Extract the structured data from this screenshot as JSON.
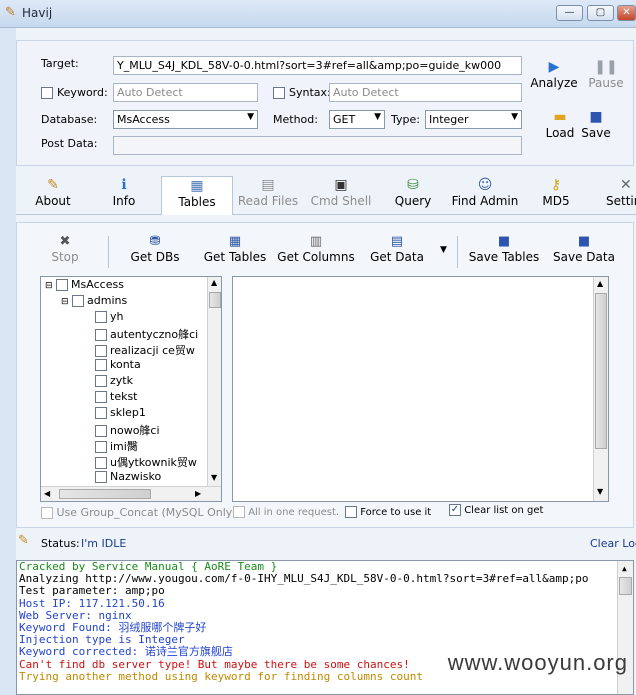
{
  "window": {
    "title": "Havij",
    "min": "▭",
    "max": "◻",
    "close": "✕"
  },
  "form": {
    "target_label": "Target:",
    "target_value": "Y_MLU_S4J_KDL_58V-0-0.html?sort=3#ref=all&amp;po=guide_kw000",
    "keyword_label": "Keyword:",
    "keyword_placeholder": "Auto Detect",
    "syntax_label": "Syntax:",
    "syntax_placeholder": "Auto Detect",
    "database_label": "Database:",
    "database_value": "MsAccess",
    "method_label": "Method:",
    "method_value": "GET",
    "type_label": "Type:",
    "type_value": "Integer",
    "postdata_label": "Post Data:",
    "analyze": "Analyze",
    "pause": "Pause",
    "load": "Load",
    "save": "Save"
  },
  "tabs": [
    {
      "label": "About",
      "icon": "brush-icon"
    },
    {
      "label": "Info",
      "icon": "info-icon"
    },
    {
      "label": "Tables",
      "icon": "table-icon"
    },
    {
      "label": "Read Files",
      "icon": "file-icon"
    },
    {
      "label": "Cmd Shell",
      "icon": "terminal-icon"
    },
    {
      "label": "Query",
      "icon": "query-icon"
    },
    {
      "label": "Find Admin",
      "icon": "users-icon"
    },
    {
      "label": "MD5",
      "icon": "key-icon"
    },
    {
      "label": "Settin",
      "icon": "tools-icon"
    }
  ],
  "toolbar": {
    "stop": "Stop",
    "get_dbs": "Get DBs",
    "get_tables": "Get Tables",
    "get_columns": "Get Columns",
    "get_data": "Get Data",
    "save_tables": "Save Tables",
    "save_data": "Save Data"
  },
  "tree": {
    "root": "MsAccess",
    "table": "admins",
    "columns": [
      "yh",
      "autentyczno艂ci",
      "realizacji ce贸w",
      "konta",
      "zytk",
      "tekst",
      "sklep1",
      "nowo艂ci",
      "imi臋",
      "u偶ytkownik贸w",
      "Nazwisko"
    ]
  },
  "options": {
    "group_concat": "Use Group_Concat (MySQL Only)",
    "one_request": "All in one request.",
    "force": "Force to use it",
    "clear_list": "Clear list on get"
  },
  "status": {
    "label": "Status:",
    "value": "I'm IDLE",
    "clear_log": "Clear Log"
  },
  "log": [
    {
      "text": "Cracked by Service Manual { AoRE Team }",
      "color": "#1a8a1a"
    },
    {
      "text": "Analyzing http://www.yougou.com/f-0-IHY_MLU_S4J_KDL_58V-0-0.html?sort=3#ref=all&amp;po",
      "color": "#000000"
    },
    {
      "text": "Test parameter: amp;po",
      "color": "#000000"
    },
    {
      "text": "Host IP: 117.121.50.16",
      "color": "#2244cc"
    },
    {
      "text": "Web Server: nginx",
      "color": "#2244cc"
    },
    {
      "text": "Keyword Found: 羽绒服哪个牌子好",
      "color": "#2244cc"
    },
    {
      "text": "Injection type is Integer",
      "color": "#2244cc"
    },
    {
      "text": "Keyword corrected: 诺诗兰官方旗舰店",
      "color": "#2244cc"
    },
    {
      "text": "Can't find db server type! But maybe there be some chances!",
      "color": "#cc1111"
    },
    {
      "text": "Trying another method using keyword for finding columns count",
      "color": "#c08a00"
    }
  ],
  "watermark": "www.wooyun.org"
}
